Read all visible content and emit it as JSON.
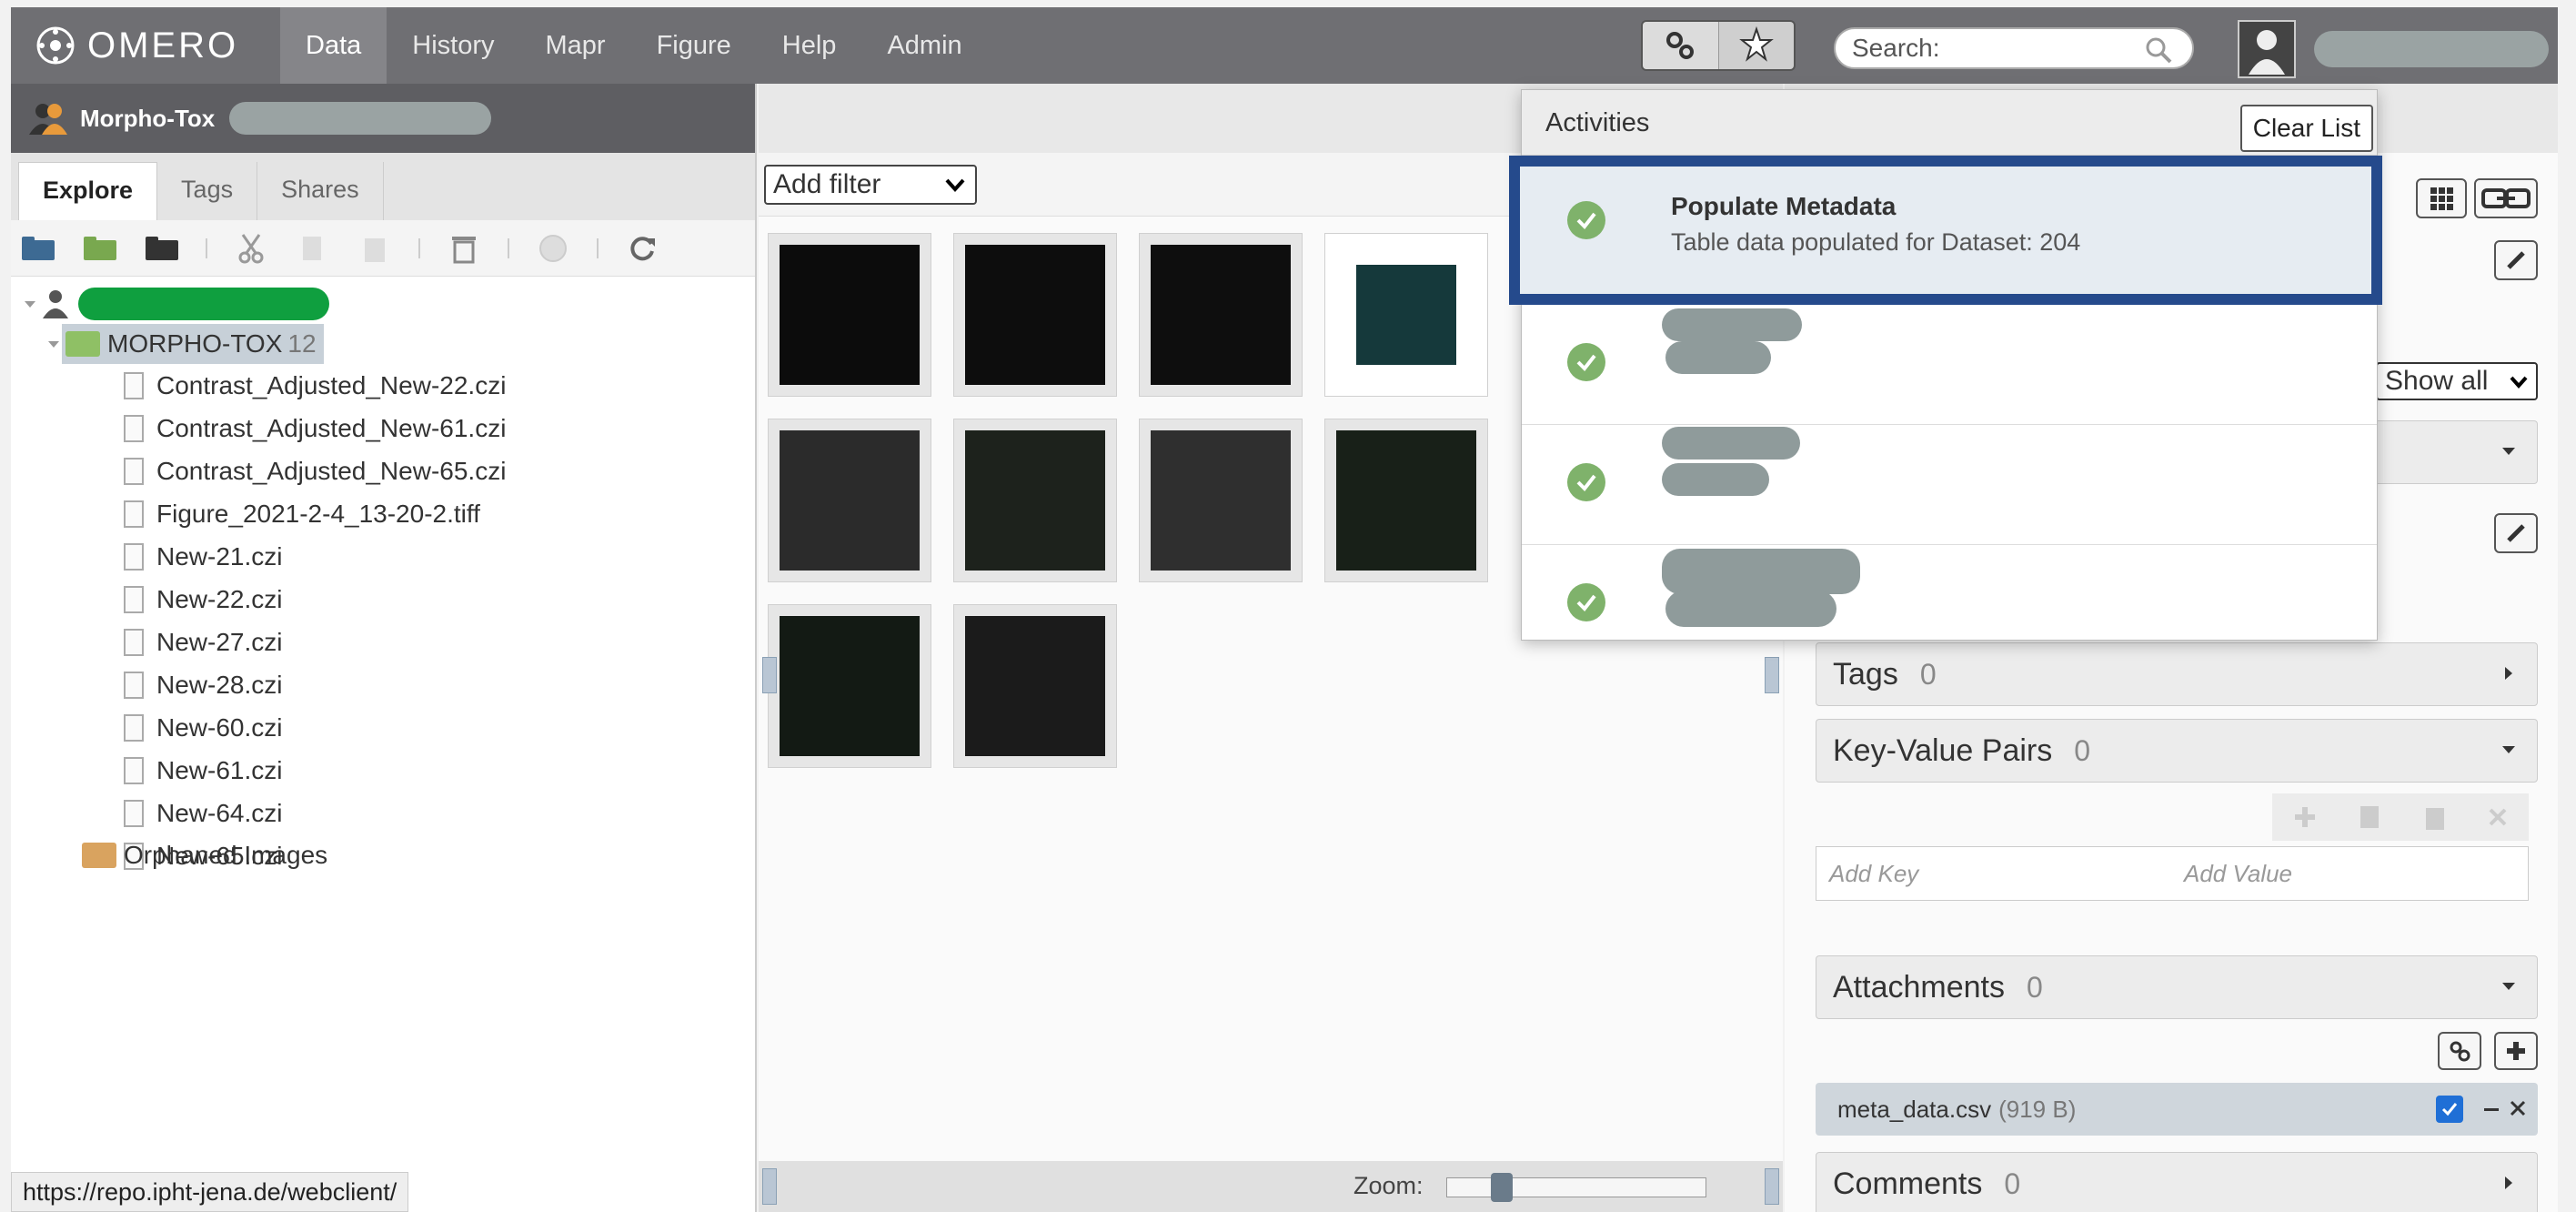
{
  "app": {
    "logo_text": "OMERO",
    "nav": [
      "Data",
      "History",
      "Mapr",
      "Figure",
      "Help",
      "Admin"
    ],
    "search_placeholder": "Search:"
  },
  "left": {
    "group_name": "Morpho-Tox",
    "tabs": [
      "Explore",
      "Tags",
      "Shares"
    ],
    "dataset_name": "MORPHO-TOX",
    "dataset_count": "12",
    "files": [
      "Contrast_Adjusted_New-22.czi",
      "Contrast_Adjusted_New-61.czi",
      "Contrast_Adjusted_New-65.czi",
      "Figure_2021-2-4_13-20-2.tiff",
      "New-21.czi",
      "New-22.czi",
      "New-27.czi",
      "New-28.czi",
      "New-60.czi",
      "New-61.czi",
      "New-64.czi",
      "New-65.czi"
    ],
    "orphaned": "Orphaned Images",
    "status_url": "https://repo.ipht-jena.de/webclient/"
  },
  "center": {
    "filter_label": "Add filter",
    "zoom_label": "Zoom:",
    "thumb_colors": [
      "#0c0c0c",
      "#0d0d0d",
      "#0e0e0e",
      "#15393b",
      "#2b2b2b",
      "#1d221c",
      "#2f2f2f",
      "#182018",
      "#131a14",
      "#1b1b1b"
    ]
  },
  "right": {
    "show_all": "Show all",
    "tags_label": "Tags",
    "tags_count": "0",
    "kv_label": "Key-Value Pairs",
    "kv_count": "0",
    "add_key": "Add Key",
    "add_value": "Add Value",
    "attachments_label": "Attachments",
    "attachments_count": "0",
    "attachment_file": "meta_data.csv",
    "attachment_size": "(919 B)",
    "comments_label": "Comments",
    "comments_count": "0"
  },
  "activities": {
    "title": "Activities",
    "clear_label": "Clear List",
    "highlight_title": "Populate Metadata",
    "highlight_msg": "Table data populated for Dataset: 204"
  },
  "colors": {
    "highlight_border": "#254a8c",
    "success_green": "#7fb26b",
    "topbar": "#6f6f73"
  }
}
